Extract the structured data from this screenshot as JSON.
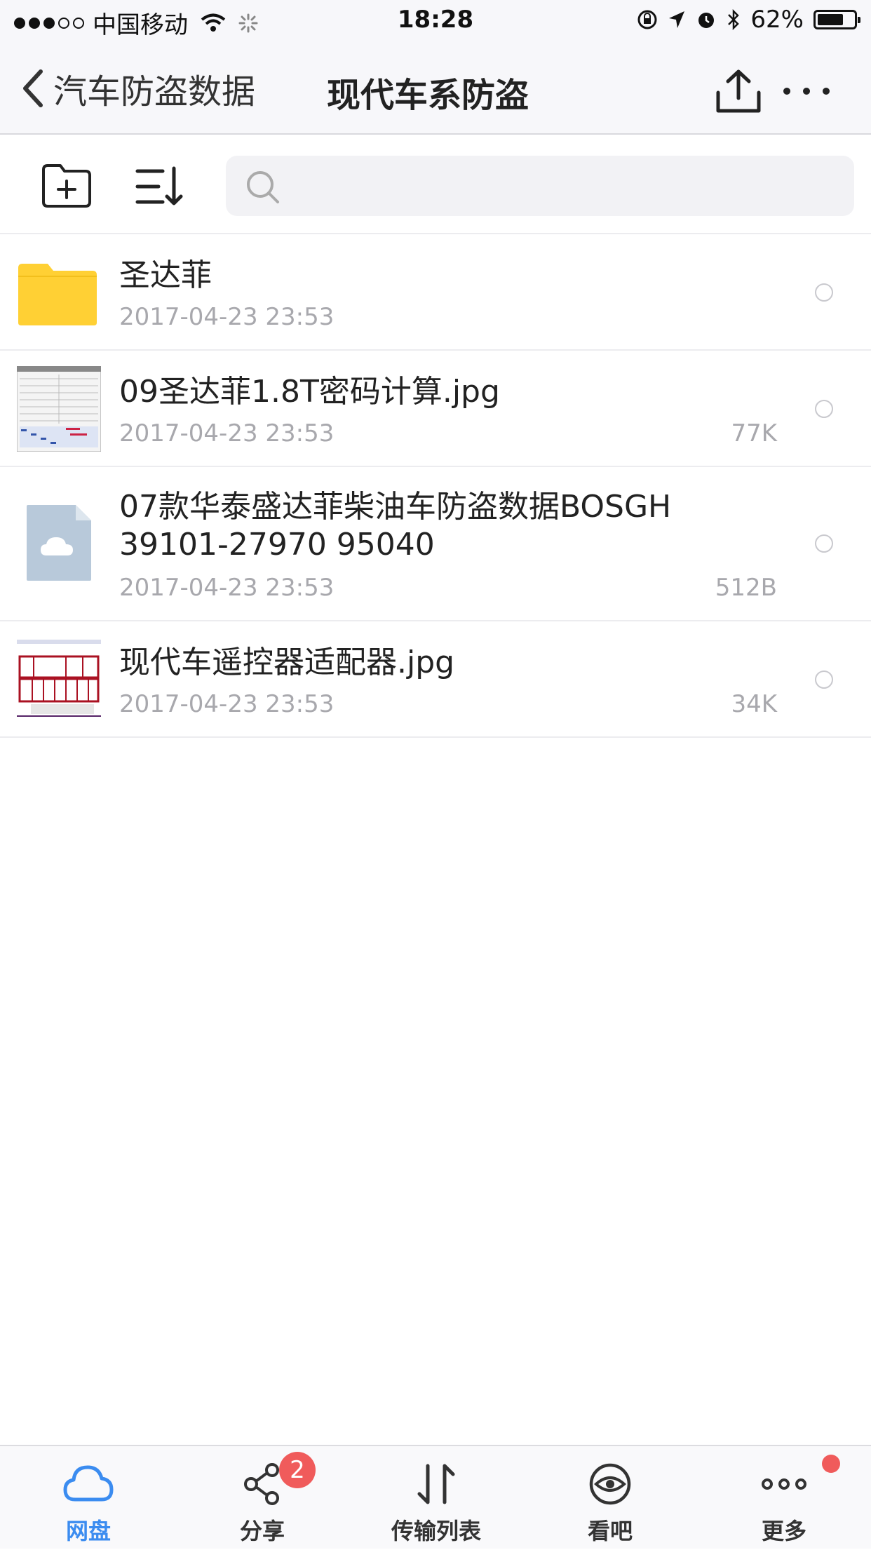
{
  "status_bar": {
    "carrier": "中国移动",
    "time": "18:28",
    "battery": "62%"
  },
  "nav": {
    "back_label": "汽车防盗数据",
    "title": "现代车系防盗"
  },
  "search": {
    "placeholder": ""
  },
  "files": [
    {
      "name": "圣达菲",
      "date": "2017-04-23 23:53",
      "size": "",
      "type": "folder"
    },
    {
      "name": "09圣达菲1.8T密码计算.jpg",
      "date": "2017-04-23 23:53",
      "size": "77K",
      "type": "image"
    },
    {
      "name_line1": "07款华泰盛达菲柴油车防盗数据BOSGH",
      "name_line2": "39101-27970 95040",
      "date": "2017-04-23 23:53",
      "size": "512B",
      "type": "cloud-file"
    },
    {
      "name": "现代车遥控器适配器.jpg",
      "date": "2017-04-23 23:53",
      "size": "34K",
      "type": "image"
    }
  ],
  "tabs": [
    {
      "label": "网盘",
      "icon": "cloud-icon",
      "active": true
    },
    {
      "label": "分享",
      "icon": "share-icon",
      "badge": "2"
    },
    {
      "label": "传输列表",
      "icon": "transfer-icon"
    },
    {
      "label": "看吧",
      "icon": "eye-icon"
    },
    {
      "label": "更多",
      "icon": "more-dots-icon",
      "dot": true
    }
  ],
  "colors": {
    "accent": "#3b8cf0",
    "folder": "#ffd034",
    "badge": "#f05b5b"
  }
}
